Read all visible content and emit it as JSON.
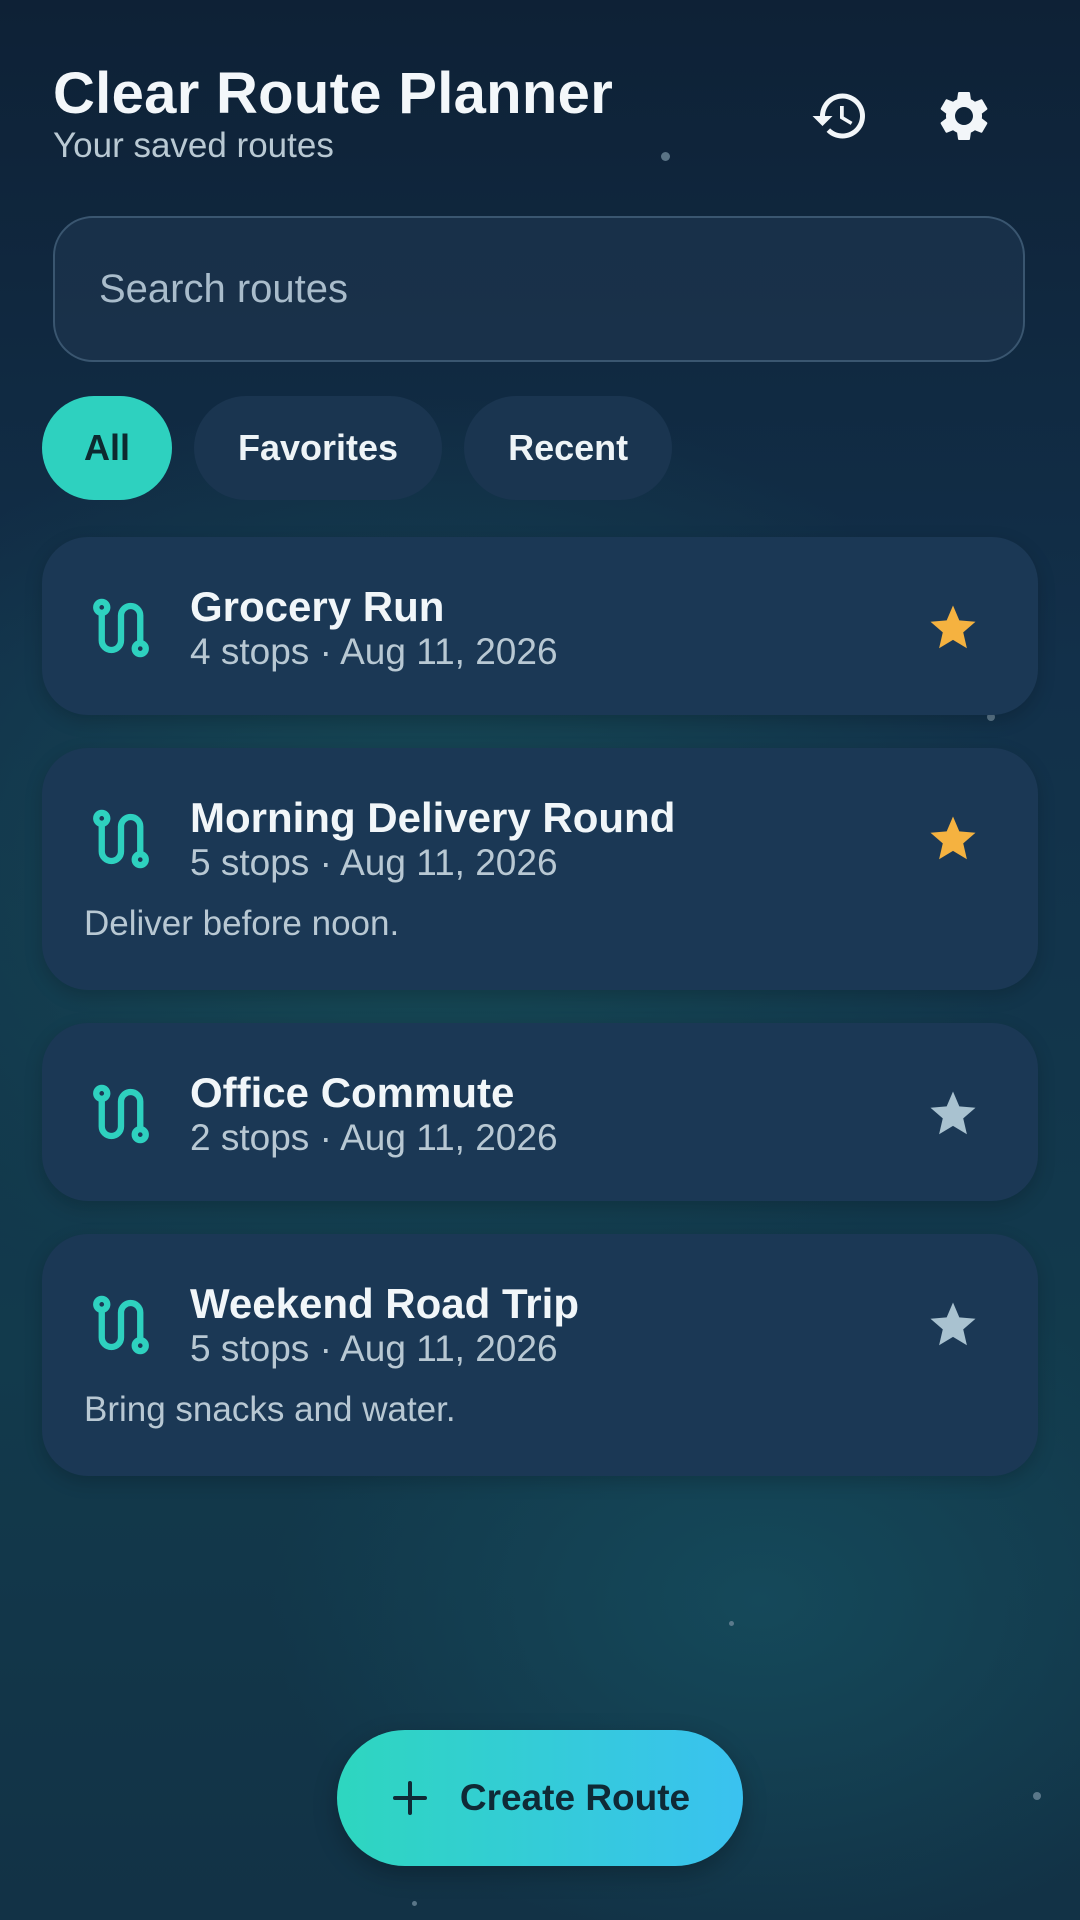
{
  "header": {
    "title": "Clear Route Planner",
    "subtitle": "Your saved routes",
    "history_icon": "history-icon",
    "settings_icon": "gear-icon"
  },
  "search": {
    "placeholder": "Search routes",
    "value": ""
  },
  "filters": [
    {
      "label": "All",
      "active": true
    },
    {
      "label": "Favorites",
      "active": false
    },
    {
      "label": "Recent",
      "active": false
    }
  ],
  "routes": [
    {
      "name": "Grocery Run",
      "meta": "4 stops · Aug 11, 2026",
      "note": "",
      "favorite": true
    },
    {
      "name": "Morning Delivery Round",
      "meta": "5 stops · Aug 11, 2026",
      "note": "Deliver before noon.",
      "favorite": true
    },
    {
      "name": "Office Commute",
      "meta": "2 stops · Aug 11, 2026",
      "note": "",
      "favorite": false
    },
    {
      "name": "Weekend Road Trip",
      "meta": "5 stops · Aug 11, 2026",
      "note": "Bring snacks and water.",
      "favorite": false
    }
  ],
  "fab": {
    "label": "Create Route",
    "icon": "plus-icon"
  },
  "colors": {
    "accent": "#2ed1bf",
    "favorite_star": "#f5b240",
    "inactive_star": "#a9c2d0",
    "card": "#1b3855"
  }
}
